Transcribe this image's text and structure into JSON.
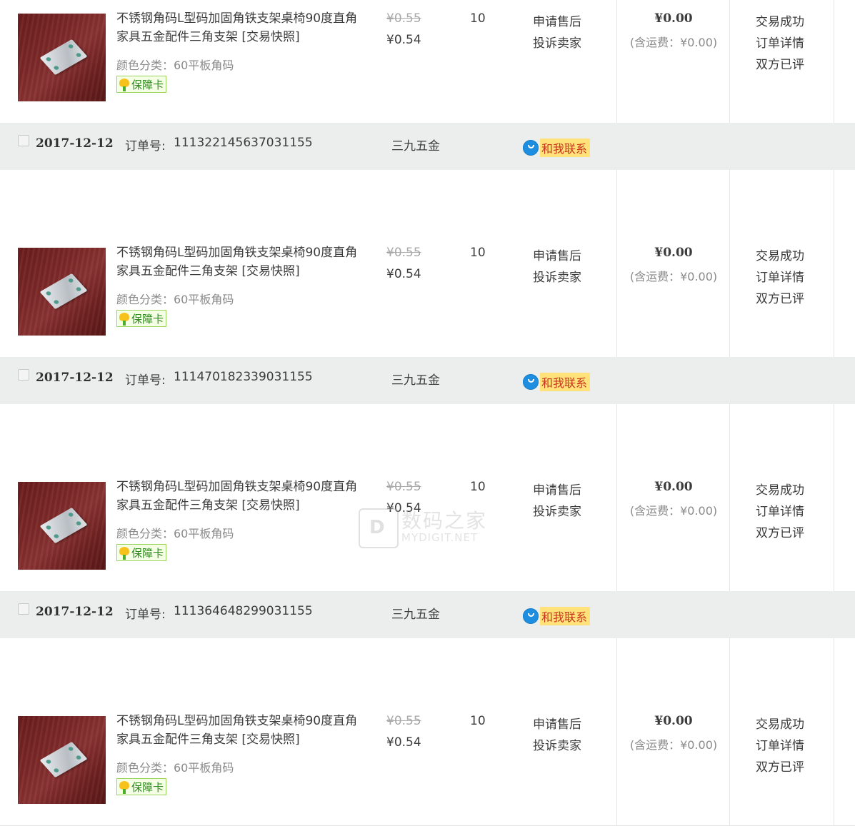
{
  "orders": [
    {
      "header": null,
      "item": {
        "title": "不锈钢角码L型码加固角铁支架桌椅90度直角家具五金配件三角支架 [交易快照]",
        "variant": "颜色分类：60平板角码",
        "badge": "保障卡",
        "price_original": "¥0.55",
        "price_current": "¥0.54",
        "quantity": "10",
        "aftersale": [
          "申请售后",
          "投诉卖家"
        ],
        "total": "¥0.00",
        "shipping": "(含运费：¥0.00)",
        "status": [
          "交易成功",
          "订单详情",
          "双方已评"
        ]
      }
    },
    {
      "header": {
        "date": "2017-12-12",
        "order_label": "订单号:",
        "order_no": "111322145637031155",
        "shop": "三九五金",
        "contact": "和我联系"
      },
      "item": {
        "title": "不锈钢角码L型码加固角铁支架桌椅90度直角家具五金配件三角支架 [交易快照]",
        "variant": "颜色分类：60平板角码",
        "badge": "保障卡",
        "price_original": "¥0.55",
        "price_current": "¥0.54",
        "quantity": "10",
        "aftersale": [
          "申请售后",
          "投诉卖家"
        ],
        "total": "¥0.00",
        "shipping": "(含运费：¥0.00)",
        "status": [
          "交易成功",
          "订单详情",
          "双方已评"
        ]
      }
    },
    {
      "header": {
        "date": "2017-12-12",
        "order_label": "订单号:",
        "order_no": "111470182339031155",
        "shop": "三九五金",
        "contact": "和我联系"
      },
      "item": {
        "title": "不锈钢角码L型码加固角铁支架桌椅90度直角家具五金配件三角支架 [交易快照]",
        "variant": "颜色分类：60平板角码",
        "badge": "保障卡",
        "price_original": "¥0.55",
        "price_current": "¥0.54",
        "quantity": "10",
        "aftersale": [
          "申请售后",
          "投诉卖家"
        ],
        "total": "¥0.00",
        "shipping": "(含运费：¥0.00)",
        "status": [
          "交易成功",
          "订单详情",
          "双方已评"
        ]
      }
    },
    {
      "header": {
        "date": "2017-12-12",
        "order_label": "订单号:",
        "order_no": "111364648299031155",
        "shop": "三九五金",
        "contact": "和我联系"
      },
      "item": {
        "title": "不锈钢角码L型码加固角铁支架桌椅90度直角家具五金配件三角支架 [交易快照]",
        "variant": "颜色分类：60平板角码",
        "badge": "保障卡",
        "price_original": "¥0.55",
        "price_current": "¥0.54",
        "quantity": "10",
        "aftersale": [
          "申请售后",
          "投诉卖家"
        ],
        "total": "¥0.00",
        "shipping": "(含运费：¥0.00)",
        "status": [
          "交易成功",
          "订单详情",
          "双方已评"
        ]
      }
    }
  ],
  "watermark": {
    "cn": "数码之家",
    "en": "MYDIGIT.NET"
  },
  "colors": {
    "header_bg": "#eceeed",
    "contact_label_bg": "#ffe27a",
    "contact_label_text": "#c8341c",
    "contact_bubble": "#1e8ee0",
    "badge_text": "#2e8b1d"
  }
}
